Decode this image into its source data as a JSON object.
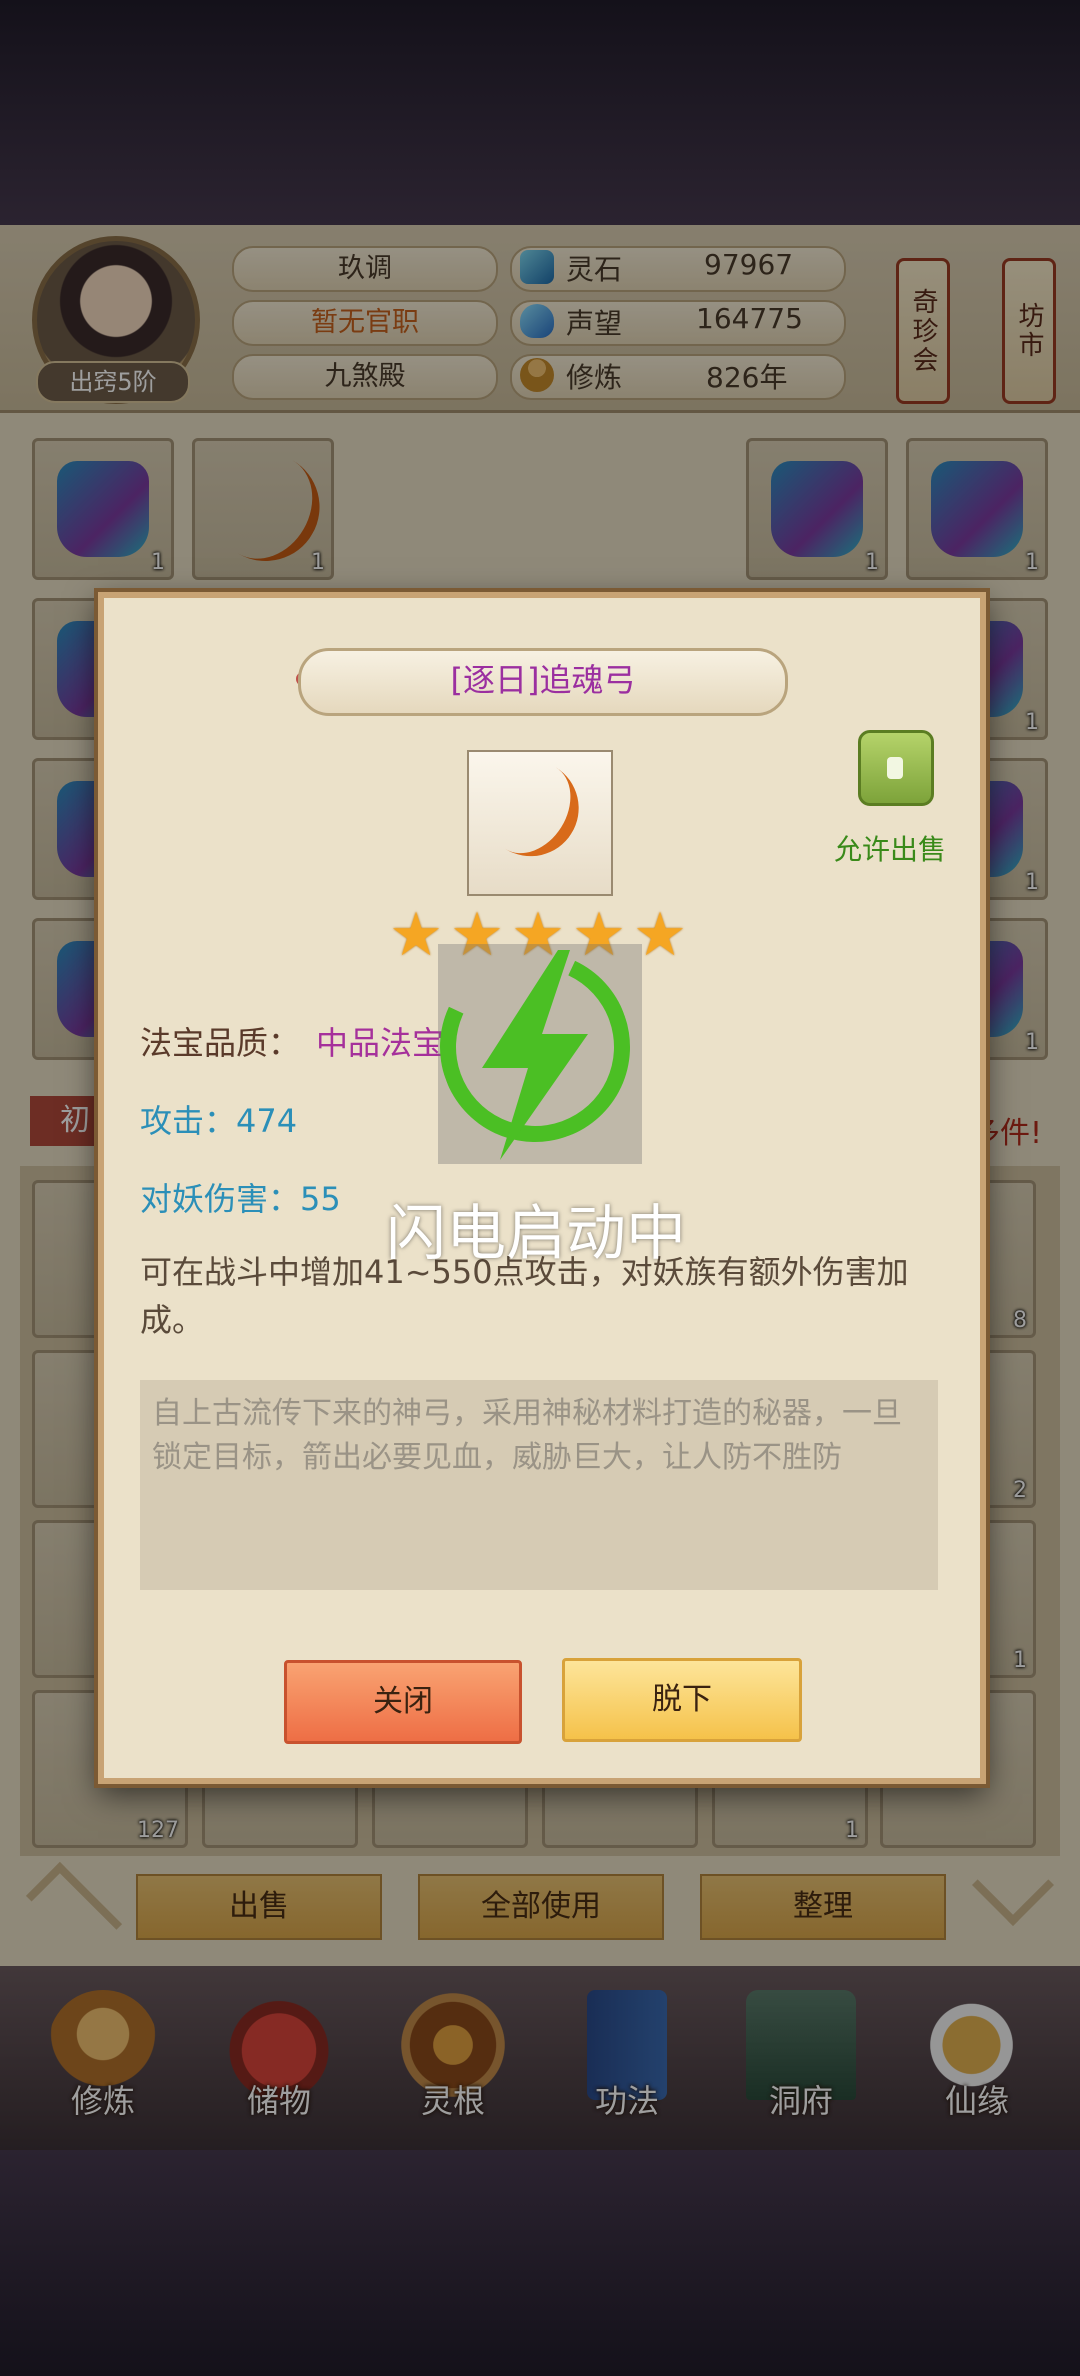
{
  "header": {
    "rank_label": "出窍5阶",
    "player_name": "玖调",
    "official_title": "暂无官职",
    "sect": "九煞殿",
    "resources": [
      {
        "icon": "spirit-stone-icon",
        "label": "灵石",
        "value": "97967"
      },
      {
        "icon": "prestige-icon",
        "label": "声望",
        "value": "164775"
      },
      {
        "icon": "cultivation-icon",
        "label": "修炼",
        "value": "826年"
      }
    ],
    "signs": [
      "奇珍会",
      "坊市"
    ]
  },
  "inventory": {
    "equip_counts": [
      "1",
      "1",
      "1",
      "1"
    ],
    "right_counts": [
      "1",
      "1",
      "1",
      "1",
      "8",
      "2",
      "1"
    ],
    "bottom_counts": [
      "127",
      "1"
    ],
    "partial_left": "初",
    "partial_right": "多件!"
  },
  "actions": {
    "sell": "出售",
    "use_all": "全部使用",
    "organize": "整理"
  },
  "nav": [
    {
      "label": "修炼",
      "icon": "meditation-icon"
    },
    {
      "label": "储物",
      "icon": "storage-bag-icon"
    },
    {
      "label": "灵根",
      "icon": "spirit-root-icon"
    },
    {
      "label": "功法",
      "icon": "scripture-book-icon"
    },
    {
      "label": "洞府",
      "icon": "cave-dwelling-icon"
    },
    {
      "label": "仙缘",
      "icon": "immortal-fate-icon"
    }
  ],
  "modal": {
    "title": "[逐日]追魂弓",
    "stars": 5,
    "allow_sale": "允许出售",
    "quality_label": "法宝品质：",
    "quality_value": "中品法宝",
    "attack": "攻击：474",
    "demon_damage": "对妖伤害：55",
    "effect": "可在战斗中增加41~550点攻击，对妖族有额外伤害加成。",
    "lore": "自上古流传下来的神弓，采用神秘材料打造的秘器，一旦锁定目标，箭出必要见血，威胁巨大，让人防不胜防",
    "close_button": "关闭",
    "unequip_button": "脱下"
  },
  "overlay": {
    "text": "闪电启动中",
    "icon": "lightning-bolt-icon",
    "accent": "#4bbf24"
  },
  "colors": {
    "title": "#9b2fa0",
    "quality_value": "#a5309b",
    "stat_blue": "#2b8fb8",
    "official_title": "#c5611d"
  }
}
